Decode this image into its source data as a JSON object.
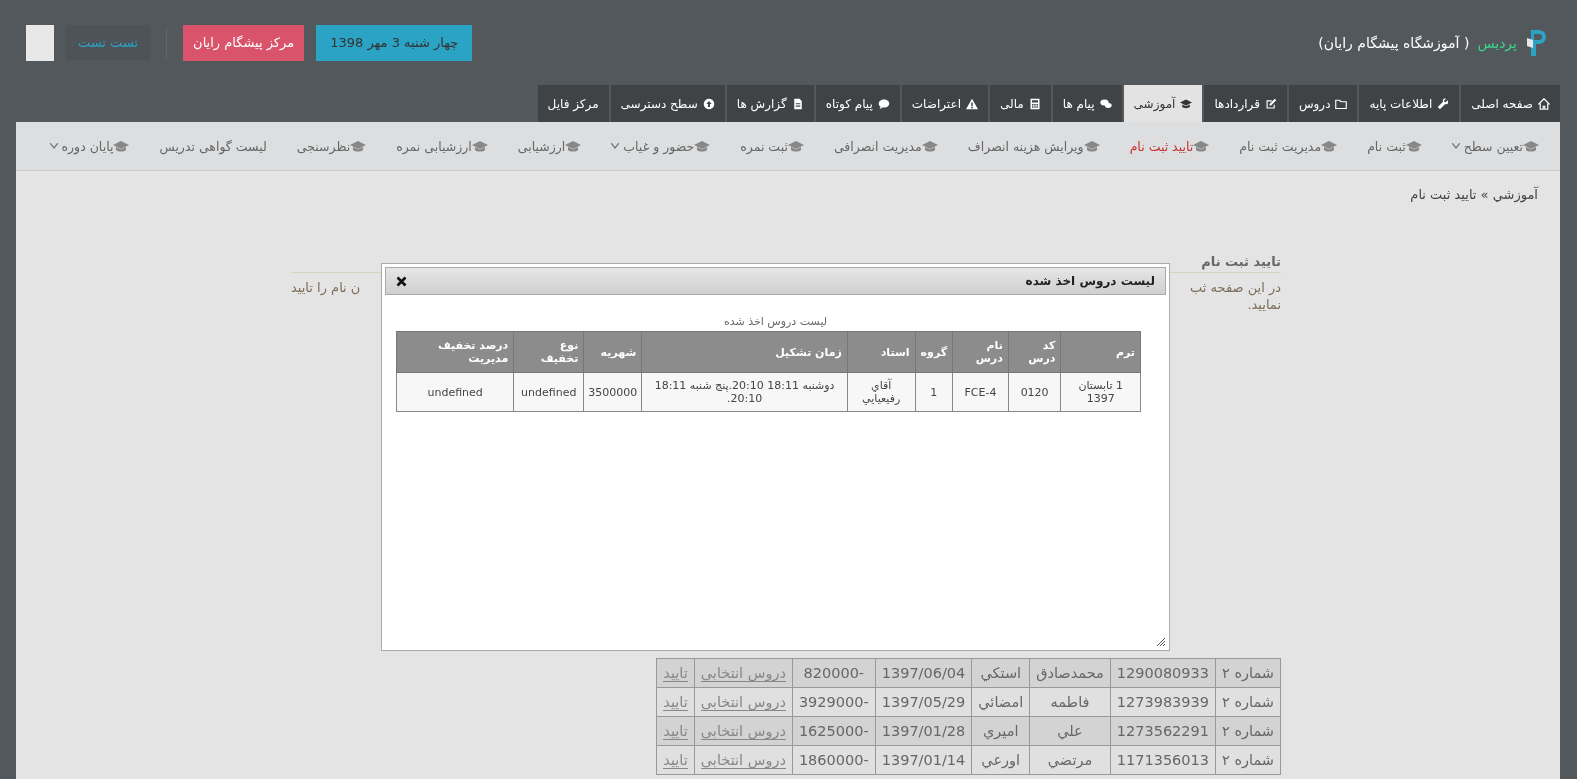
{
  "header": {
    "brand": "پردیس",
    "school": "( آموزشگاه پیشگام رایان)",
    "date_button": "چهار شنبه 3 مهر 1398",
    "center_button": "مرکز پیشگام رایان",
    "user_name": "تست تست"
  },
  "tabs": [
    {
      "label": "صفحه اصلی",
      "selected": false
    },
    {
      "label": "اطلاعات پایه",
      "selected": false
    },
    {
      "label": "دروس",
      "selected": false
    },
    {
      "label": "قراردادها",
      "selected": false
    },
    {
      "label": "آموزشی",
      "selected": true
    },
    {
      "label": "پیام ها",
      "selected": false
    },
    {
      "label": "مالی",
      "selected": false
    },
    {
      "label": "اعتراضات",
      "selected": false
    },
    {
      "label": "پیام کوتاه",
      "selected": false
    },
    {
      "label": "گزارش ها",
      "selected": false
    },
    {
      "label": "سطح دسترسی",
      "selected": false
    },
    {
      "label": "مرکز فایل",
      "selected": false
    }
  ],
  "subnav": [
    {
      "label": "تعیین سطح",
      "selected": false,
      "dropdown": true
    },
    {
      "label": "ثبت نام",
      "selected": false,
      "dropdown": false
    },
    {
      "label": "مدیریت ثبت نام",
      "selected": false,
      "dropdown": false
    },
    {
      "label": "تایید ثبت نام",
      "selected": true,
      "dropdown": false
    },
    {
      "label": "ویرایش هزینه انصراف",
      "selected": false,
      "dropdown": false
    },
    {
      "label": "مدیریت انصرافی",
      "selected": false,
      "dropdown": false
    },
    {
      "label": "ثبت نمره",
      "selected": false,
      "dropdown": false
    },
    {
      "label": "حضور و غیاب",
      "selected": false,
      "dropdown": true
    },
    {
      "label": "ارزشیابی",
      "selected": false,
      "dropdown": false
    },
    {
      "label": "ارزشیابی نمره",
      "selected": false,
      "dropdown": false
    },
    {
      "label": "نظرسنجی",
      "selected": false,
      "dropdown": false
    },
    {
      "label": "لیست گواهی تدریس",
      "selected": false,
      "dropdown": false
    },
    {
      "label": "پایان دوره",
      "selected": false,
      "dropdown": true
    }
  ],
  "breadcrumb": "آموزشي » تایید ثبت نام",
  "section": {
    "title": "تایید ثبت نام",
    "text_right": "در این صفحه ثب",
    "text_left": "ن نام را تایید",
    "text_line2": "نمایید."
  },
  "dialog": {
    "title": "لیست دروس اخذ شده",
    "caption": "لیست دروس اخذ شده",
    "columns": [
      "ترم",
      "کد درس",
      "نام درس",
      "گروه",
      "استاد",
      "زمان تشکیل",
      "شهریه",
      "نوع تخفیف",
      "درصد تخفیف مدیریت"
    ],
    "rows": [
      [
        "1 تابستان 1397",
        "0120",
        "FCE-4",
        "1",
        "آقاي رفيعيايي",
        "دوشنبه 18:11 20:10.پنج شنبه 18:11 20:10.",
        "3500000",
        "undefined",
        "undefined"
      ]
    ]
  },
  "students": {
    "rows": [
      [
        "شماره ۲",
        "1290080933",
        "محمدصادق",
        "استكي",
        "1397/06/04",
        "-820000",
        "دروس انتخابی",
        "تایید"
      ],
      [
        "شماره ۲",
        "1273983939",
        "فاطمه",
        "امضائي",
        "1397/05/29",
        "-3929000",
        "دروس انتخابی",
        "تایید"
      ],
      [
        "شماره ۲",
        "1273562291",
        "علي",
        "اميري",
        "1397/01/28",
        "-1625000",
        "دروس انتخابی",
        "تایید"
      ],
      [
        "شماره ۲",
        "1171356013",
        "مرتضي",
        "اورعي",
        "1397/01/14",
        "-1860000",
        "دروس انتخابی",
        "تایید"
      ]
    ]
  }
}
